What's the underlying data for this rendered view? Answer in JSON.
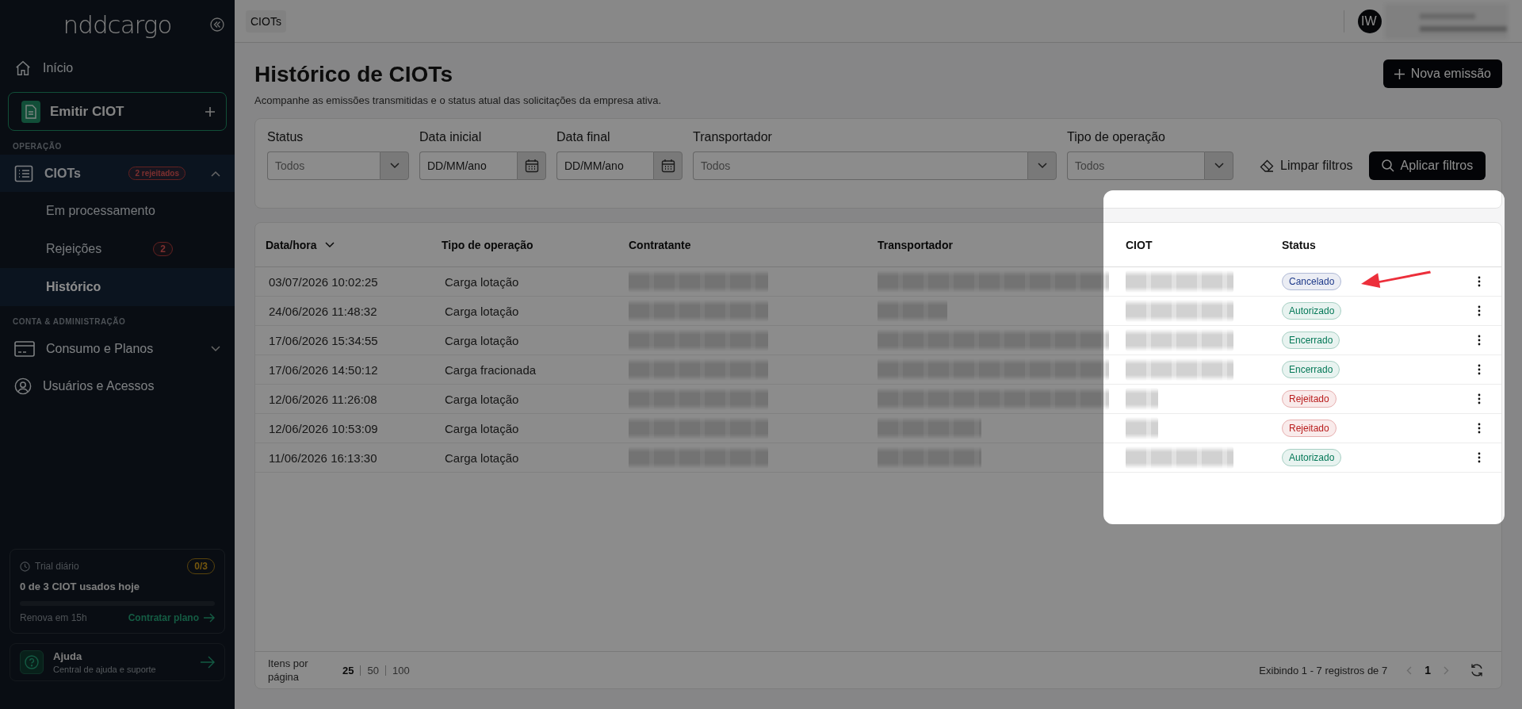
{
  "topbar": {
    "breadcrumb": "CIOTs",
    "user": {
      "initials": "IW"
    }
  },
  "sidebar": {
    "logo": "nddcargo",
    "home": "Início",
    "primary_action": "Emitir CIOT",
    "sections": [
      {
        "title": "OPERAÇÃO",
        "items": [
          {
            "label": "CIOTs",
            "badge": "2 rejeitados",
            "expanded": true,
            "children": [
              {
                "label": "Em processamento",
                "selected": false
              },
              {
                "label": "Rejeições",
                "badge": "2",
                "selected": false
              },
              {
                "label": "Histórico",
                "selected": true
              }
            ]
          }
        ]
      },
      {
        "title": "CONTA & ADMINISTRAÇÃO",
        "items": [
          {
            "label": "Consumo e Planos",
            "expanded": false
          },
          {
            "label": "Usuários e Acessos"
          }
        ]
      }
    ],
    "trial": {
      "title": "Trial diário",
      "badge": "0/3",
      "summary": "0 de 3 CIOT usados hoje",
      "level": 0,
      "renewal": "Renova em 15h",
      "link": "Contratar plano"
    },
    "help": {
      "title": "Ajuda",
      "subtitle": "Central de ajuda e suporte"
    }
  },
  "page": {
    "title": "Histórico de CIOTs",
    "subtitle": "Acompanhe as emissões transmitidas e o status atual das solicitações da empresa ativa.",
    "primary_button": "Nova emissão"
  },
  "filters": {
    "fields": [
      {
        "label": "Status",
        "kind": "select",
        "placeholder": "Todos"
      },
      {
        "label": "Data inicial",
        "kind": "date",
        "placeholder": "DD/MM/ano"
      },
      {
        "label": "Data final",
        "kind": "date",
        "placeholder": "DD/MM/ano"
      },
      {
        "label": "Transportador",
        "kind": "select",
        "placeholder": "Todos"
      },
      {
        "label": "Tipo de operação",
        "kind": "select",
        "placeholder": "Todos"
      }
    ],
    "clear_button": "Limpar filtros",
    "apply_button": "Aplicar filtros"
  },
  "table": {
    "columns": [
      {
        "label": "Data/hora",
        "sorted": true
      },
      {
        "label": "Tipo de operação",
        "sorted": false
      },
      {
        "label": "Contratante",
        "sorted": false
      },
      {
        "label": "Transportador",
        "sorted": false
      },
      {
        "label": "CIOT",
        "sorted": false
      },
      {
        "label": "Status",
        "sorted": false
      }
    ],
    "rows": [
      {
        "date": "03/07/2026 10:02:25",
        "operation": "Carga lotação",
        "contratante": {
          "kind": "blurred_long"
        },
        "transportador": {
          "kind": "blurred_long"
        },
        "ciot": {
          "kind": "blurred_long"
        },
        "status": {
          "label": "Cancelado",
          "color": "#1e3a8a"
        }
      },
      {
        "date": "24/06/2026 11:48:32",
        "operation": "Carga lotação",
        "contratante": {
          "kind": "blurred_long"
        },
        "transportador": {
          "kind": "blurred_short"
        },
        "ciot": {
          "kind": "blurred_long"
        },
        "status": {
          "label": "Autorizado",
          "color": "#047857"
        }
      },
      {
        "date": "17/06/2026 15:34:55",
        "operation": "Carga lotação",
        "contratante": {
          "kind": "blurred_long"
        },
        "transportador": {
          "kind": "blurred_long"
        },
        "ciot": {
          "kind": "blurred_long"
        },
        "status": {
          "label": "Encerrado",
          "color": "#047857"
        }
      },
      {
        "date": "17/06/2026 14:50:12",
        "operation": "Carga fracionada",
        "contratante": {
          "kind": "blurred_long"
        },
        "transportador": {
          "kind": "blurred_long"
        },
        "ciot": {
          "kind": "blurred_long"
        },
        "status": {
          "label": "Encerrado",
          "color": "#047857"
        }
      },
      {
        "date": "12/06/2026 11:26:08",
        "operation": "Carga lotação",
        "contratante": {
          "kind": "blurred_long"
        },
        "transportador": {
          "kind": "blurred_long"
        },
        "ciot": {
          "kind": "blurred_short"
        },
        "status": {
          "label": "Rejeitado",
          "color": "#b91c1c"
        }
      },
      {
        "date": "12/06/2026 10:53:09",
        "operation": "Carga lotação",
        "contratante": {
          "kind": "blurred_long"
        },
        "transportador": {
          "kind": "blurred_medium"
        },
        "ciot": {
          "kind": "blurred_short"
        },
        "status": {
          "label": "Rejeitado",
          "color": "#b91c1c"
        }
      },
      {
        "date": "11/06/2026 16:13:30",
        "operation": "Carga lotação",
        "contratante": {
          "kind": "blurred_long"
        },
        "transportador": {
          "kind": "blurred_medium"
        },
        "ciot": {
          "kind": "blurred_long"
        },
        "status": {
          "label": "Autorizado",
          "color": "#047857"
        }
      }
    ],
    "footer": {
      "page_size_label": "Itens por página",
      "page_sizes": [
        {
          "label": "25",
          "selected": true
        },
        {
          "label": "50",
          "selected": false
        },
        {
          "label": "100",
          "selected": false
        }
      ],
      "summary": "Exibindo 1 - 7 registros de 7",
      "pages": [
        {
          "label": "1",
          "selected": true
        }
      ],
      "prev_disabled": true,
      "next_disabled": true
    }
  }
}
